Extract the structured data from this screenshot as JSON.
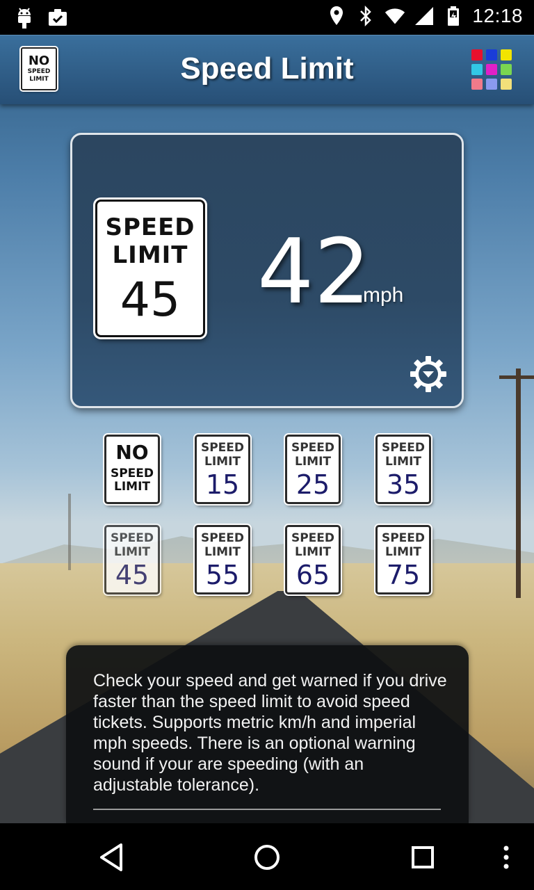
{
  "status_bar": {
    "time": "12:18",
    "left_icons": [
      "android-icon",
      "clipboard-check-icon"
    ],
    "right_icons": [
      "location-pin-icon",
      "bluetooth-icon",
      "wifi-icon",
      "signal-icon",
      "battery-icon"
    ]
  },
  "action_bar": {
    "title": "Speed Limit",
    "logo": {
      "line1": "NO",
      "line2": "SPEED",
      "line3": "LIMIT"
    },
    "menu_grid_colors": [
      "#e8112d",
      "#1a3cd8",
      "#f2e400",
      "#32c8e6",
      "#e020c8",
      "#7ad650",
      "#f07a8a",
      "#8a9af0",
      "#f2e07a"
    ]
  },
  "display": {
    "current_limit_sign": {
      "line1": "SPEED",
      "line2": "LIMIT",
      "value": "45"
    },
    "current_speed": "42",
    "speed_unit": "mph"
  },
  "limit_options": [
    {
      "line1": "NO",
      "line2": "SPEED",
      "line3": "LIMIT",
      "value": "",
      "type": "none"
    },
    {
      "line1": "SPEED",
      "line2": "LIMIT",
      "value": "15"
    },
    {
      "line1": "SPEED",
      "line2": "LIMIT",
      "value": "25"
    },
    {
      "line1": "SPEED",
      "line2": "LIMIT",
      "value": "35"
    },
    {
      "line1": "SPEED",
      "line2": "LIMIT",
      "value": "45",
      "selected": true
    },
    {
      "line1": "SPEED",
      "line2": "LIMIT",
      "value": "55"
    },
    {
      "line1": "SPEED",
      "line2": "LIMIT",
      "value": "65"
    },
    {
      "line1": "SPEED",
      "line2": "LIMIT",
      "value": "75"
    }
  ],
  "description": "Check your speed and get warned if you drive faster than the speed limit to avoid speed tickets. Supports metric km/h and imperial mph speeds. There is an optional warning sound if your are speeding (with an adjustable tolerance).",
  "nav_bar": {
    "buttons": [
      "back-icon",
      "home-icon",
      "recents-icon",
      "overflow-menu-icon"
    ]
  }
}
